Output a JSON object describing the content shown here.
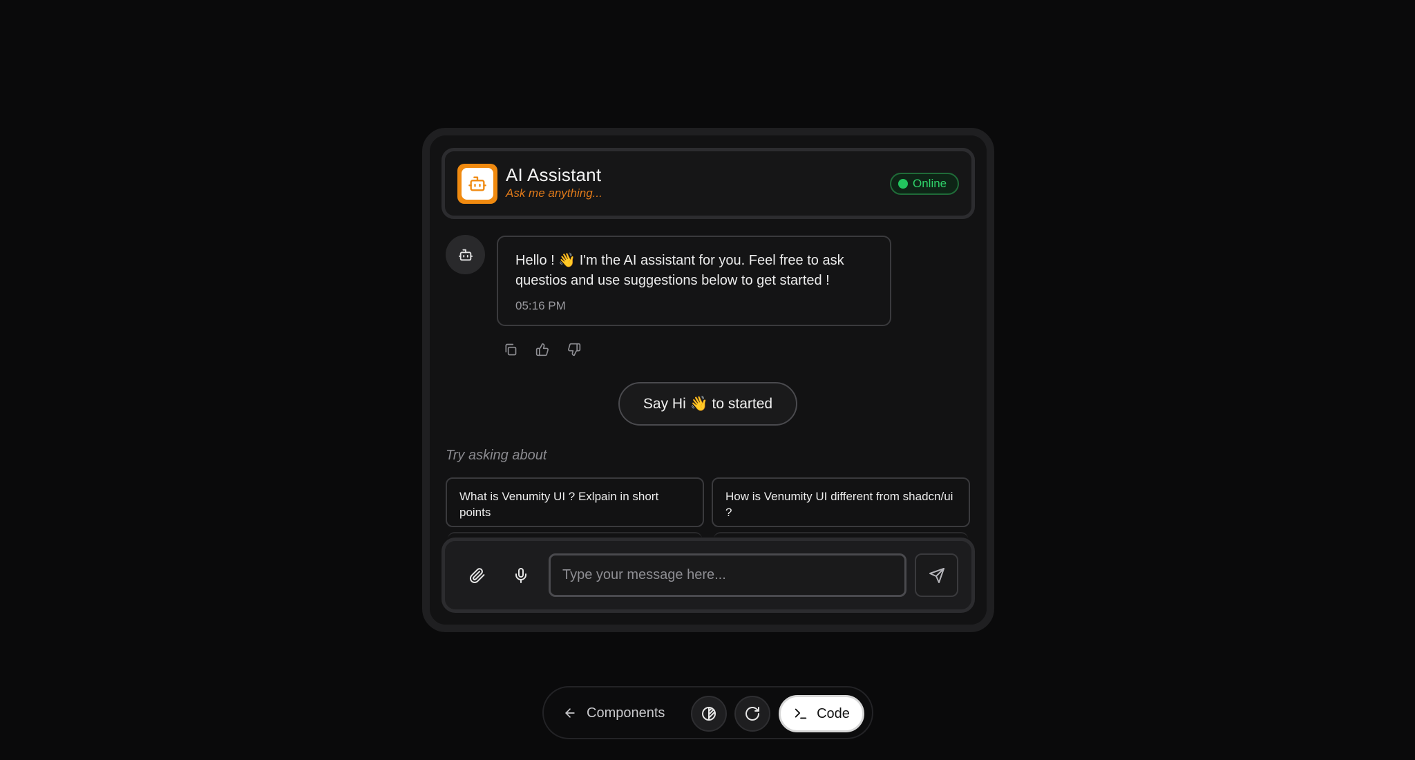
{
  "header": {
    "title": "AI Assistant",
    "subtitle": "Ask me anything...",
    "status": "Online"
  },
  "message": {
    "text": "Hello ! 👋 I'm the AI assistant for you. Feel free to ask questios and use suggestions below to get started !",
    "time": "05:16 PM"
  },
  "say_hi": "Say Hi 👋 to started",
  "suggestions": {
    "label": "Try asking about",
    "items": [
      "What is Venumity UI ? Exlpain in short points",
      "How is Venumity UI different from shadcn/ui ?"
    ]
  },
  "composer": {
    "placeholder": "Type your message here..."
  },
  "toolbar": {
    "back_label": "Components",
    "code_label": "Code"
  },
  "colors": {
    "accent": "#f08a10",
    "online": "#22c55e"
  }
}
